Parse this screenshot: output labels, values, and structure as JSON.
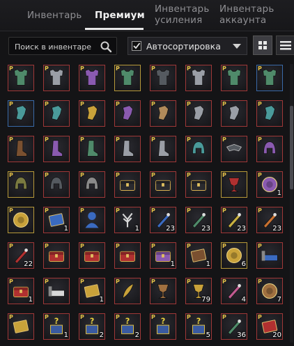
{
  "tabs": [
    {
      "label_1": "Инвентарь",
      "label_2": "",
      "active": false
    },
    {
      "label_1": "Премиум",
      "label_2": "",
      "active": true
    },
    {
      "label_1": "Инвентарь",
      "label_2": "усиления",
      "active": false
    },
    {
      "label_1": "Инвентарь",
      "label_2": "аккаунта",
      "active": false
    }
  ],
  "search": {
    "placeholder": "Поиск в инвентаре",
    "value": ""
  },
  "autosort": {
    "label": "Автосортировка",
    "checked": true
  },
  "view": {
    "selected": "grid"
  },
  "grid": {
    "badge": "P",
    "rows": [
      [
        {
          "icon": "armor-green",
          "frame": "red",
          "count": ""
        },
        {
          "icon": "armor-plate-silver",
          "frame": "red",
          "count": ""
        },
        {
          "icon": "armor-purple",
          "frame": "red",
          "count": ""
        },
        {
          "icon": "armor-green-tunic",
          "frame": "gold",
          "count": ""
        },
        {
          "icon": "armor-plate-dark",
          "frame": "red",
          "count": ""
        },
        {
          "icon": "armor-plate-silver",
          "frame": "red",
          "count": ""
        },
        {
          "icon": "armor-plate-green",
          "frame": "red",
          "count": ""
        },
        {
          "icon": "armor-plate-green",
          "frame": "blue",
          "count": ""
        }
      ],
      [
        {
          "icon": "gauntlet-teal",
          "frame": "blue",
          "count": ""
        },
        {
          "icon": "gauntlet-teal",
          "frame": "red",
          "count": ""
        },
        {
          "icon": "gauntlet-gold",
          "frame": "red",
          "count": ""
        },
        {
          "icon": "gauntlet-purple",
          "frame": "red",
          "count": ""
        },
        {
          "icon": "glove-tan",
          "frame": "red",
          "count": ""
        },
        {
          "icon": "gauntlet-silver",
          "frame": "red",
          "count": ""
        },
        {
          "icon": "gauntlet-silver",
          "frame": "red",
          "count": ""
        },
        {
          "icon": "gauntlet-teal",
          "frame": "red",
          "count": ""
        }
      ],
      [
        {
          "icon": "boots-brown",
          "frame": "red",
          "count": ""
        },
        {
          "icon": "boots-purple",
          "frame": "red",
          "count": ""
        },
        {
          "icon": "boots-green",
          "frame": "red",
          "count": ""
        },
        {
          "icon": "boots-silver",
          "frame": "red",
          "count": ""
        },
        {
          "icon": "boots-silver",
          "frame": "red",
          "count": ""
        },
        {
          "icon": "helm-teal",
          "frame": "red",
          "count": ""
        },
        {
          "icon": "mask-dark",
          "frame": "red",
          "count": ""
        },
        {
          "icon": "helm-purple",
          "frame": "red",
          "count": ""
        }
      ],
      [
        {
          "icon": "hood-olive",
          "frame": "gold",
          "count": ""
        },
        {
          "icon": "helm-dark",
          "frame": "red",
          "count": ""
        },
        {
          "icon": "helm-knight",
          "frame": "red",
          "count": ""
        },
        {
          "icon": "chest-black",
          "frame": "red",
          "count": ""
        },
        {
          "icon": "chest-black",
          "frame": "red",
          "count": ""
        },
        {
          "icon": "chest-black",
          "frame": "red",
          "count": ""
        },
        {
          "icon": "chalice-red",
          "frame": "gold",
          "count": ""
        },
        {
          "icon": "orb-purple",
          "frame": "red",
          "count": "1"
        }
      ],
      [
        {
          "icon": "compass-gold",
          "frame": "gold",
          "count": ""
        },
        {
          "icon": "scroll-blue",
          "frame": "red",
          "count": "1"
        },
        {
          "icon": "bust-blue",
          "frame": "red",
          "count": ""
        },
        {
          "icon": "tree-white",
          "frame": "red",
          "count": "1"
        },
        {
          "icon": "potion-blue",
          "frame": "red",
          "count": "23"
        },
        {
          "icon": "potion-green",
          "frame": "red",
          "count": "23"
        },
        {
          "icon": "potion-yellow",
          "frame": "red",
          "count": "23"
        },
        {
          "icon": "potion-orange",
          "frame": "red",
          "count": "23"
        }
      ],
      [
        {
          "icon": "syringe-red",
          "frame": "red",
          "count": "22"
        },
        {
          "icon": "chest-red",
          "frame": "red",
          "count": ""
        },
        {
          "icon": "chest-red",
          "frame": "red",
          "count": ""
        },
        {
          "icon": "chest-red",
          "frame": "red",
          "count": ""
        },
        {
          "icon": "chest-purple",
          "frame": "red",
          "count": "1"
        },
        {
          "icon": "ticket-brown",
          "frame": "red",
          "count": "1"
        },
        {
          "icon": "coin-gold",
          "frame": "gold",
          "count": "6"
        },
        {
          "icon": "bed-blue",
          "frame": "red",
          "count": ""
        }
      ],
      [
        {
          "icon": "chest-red",
          "frame": "red",
          "count": "1"
        },
        {
          "icon": "bed-white",
          "frame": "red",
          "count": ""
        },
        {
          "icon": "ticket-gold",
          "frame": "red",
          "count": "1"
        },
        {
          "icon": "feather-gold",
          "frame": "red",
          "count": ""
        },
        {
          "icon": "trophy-bronze",
          "frame": "red",
          "count": ""
        },
        {
          "icon": "lamp-gold",
          "frame": "red",
          "count": "79"
        },
        {
          "icon": "potion-pink",
          "frame": "red",
          "count": "4"
        },
        {
          "icon": "coin-bronze",
          "frame": "red",
          "count": "7"
        }
      ],
      [
        {
          "icon": "card-gold",
          "frame": "red",
          "count": ""
        },
        {
          "icon": "mystery-box",
          "frame": "red",
          "count": "1"
        },
        {
          "icon": "mystery-box",
          "frame": "red",
          "count": "2"
        },
        {
          "icon": "mystery-box",
          "frame": "red",
          "count": "2"
        },
        {
          "icon": "mystery-box-multi",
          "frame": "red",
          "count": ""
        },
        {
          "icon": "mystery-box",
          "frame": "red",
          "count": "5"
        },
        {
          "icon": "flask-green",
          "frame": "red",
          "count": "36"
        },
        {
          "icon": "book-red",
          "frame": "red",
          "count": "20"
        }
      ]
    ]
  },
  "colors": {
    "accent": "#e8e8e8",
    "badge": "#e6c24a",
    "frame_red": "#a03838",
    "frame_gold": "#b89a3a",
    "frame_blue": "#3a6aa8"
  }
}
